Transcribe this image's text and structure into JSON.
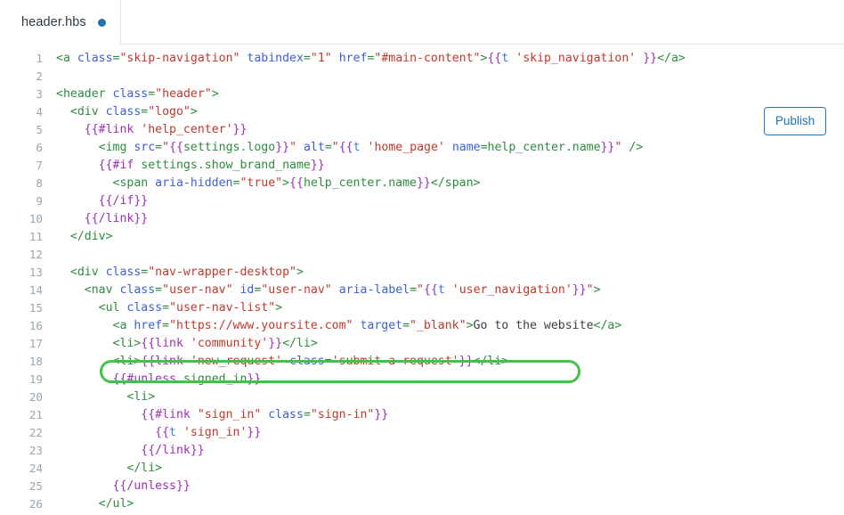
{
  "tab": {
    "filename": "header.hbs",
    "unsaved_indicator": "unsaved-dot",
    "accent_color": "#1f73b7"
  },
  "toolbar": {
    "publish_label": "Publish",
    "publish_color": "#1f73b7"
  },
  "highlight": {
    "color": "#44c148",
    "target_line": 16
  },
  "editor": {
    "language": "handlebars",
    "first_visible_line": 1,
    "last_visible_line": 26,
    "lines": [
      {
        "n": "1",
        "tokens": [
          {
            "t": "tag",
            "s": "<a "
          },
          {
            "t": "attr",
            "s": "class"
          },
          {
            "t": "tag",
            "s": "="
          },
          {
            "t": "str",
            "s": "\"skip-navigation\""
          },
          {
            "t": "tag",
            "s": " "
          },
          {
            "t": "attr",
            "s": "tabindex"
          },
          {
            "t": "tag",
            "s": "="
          },
          {
            "t": "str",
            "s": "\"1\""
          },
          {
            "t": "tag",
            "s": " "
          },
          {
            "t": "attr",
            "s": "href"
          },
          {
            "t": "tag",
            "s": "="
          },
          {
            "t": "str",
            "s": "\"#main-content\""
          },
          {
            "t": "tag",
            "s": ">"
          },
          {
            "t": "hb",
            "s": "{{"
          },
          {
            "t": "hbid",
            "s": "t"
          },
          {
            "t": "plain",
            "s": " "
          },
          {
            "t": "str",
            "s": "'skip_navigation'"
          },
          {
            "t": "plain",
            "s": " "
          },
          {
            "t": "hb",
            "s": "}}"
          },
          {
            "t": "tag",
            "s": "</a>"
          }
        ]
      },
      {
        "n": "2",
        "tokens": []
      },
      {
        "n": "3",
        "tokens": [
          {
            "t": "tag",
            "s": "<header "
          },
          {
            "t": "attr",
            "s": "class"
          },
          {
            "t": "tag",
            "s": "="
          },
          {
            "t": "str",
            "s": "\"header\""
          },
          {
            "t": "tag",
            "s": ">"
          }
        ]
      },
      {
        "n": "4",
        "tokens": [
          {
            "t": "tag",
            "s": "  <div "
          },
          {
            "t": "attr",
            "s": "class"
          },
          {
            "t": "tag",
            "s": "="
          },
          {
            "t": "str",
            "s": "\"logo\""
          },
          {
            "t": "tag",
            "s": ">"
          }
        ]
      },
      {
        "n": "5",
        "tokens": [
          {
            "t": "plain",
            "s": "    "
          },
          {
            "t": "hb",
            "s": "{{#link"
          },
          {
            "t": "plain",
            "s": " "
          },
          {
            "t": "str",
            "s": "'help_center'"
          },
          {
            "t": "hb",
            "s": "}}"
          }
        ]
      },
      {
        "n": "6",
        "tokens": [
          {
            "t": "tag",
            "s": "      <img "
          },
          {
            "t": "attr",
            "s": "src"
          },
          {
            "t": "tag",
            "s": "="
          },
          {
            "t": "str",
            "s": "\""
          },
          {
            "t": "hb",
            "s": "{{"
          },
          {
            "t": "hbvar",
            "s": "settings.logo"
          },
          {
            "t": "hb",
            "s": "}}"
          },
          {
            "t": "str",
            "s": "\""
          },
          {
            "t": "tag",
            "s": " "
          },
          {
            "t": "attr",
            "s": "alt"
          },
          {
            "t": "tag",
            "s": "="
          },
          {
            "t": "str",
            "s": "\""
          },
          {
            "t": "hb",
            "s": "{{"
          },
          {
            "t": "hbid",
            "s": "t"
          },
          {
            "t": "plain",
            "s": " "
          },
          {
            "t": "str",
            "s": "'home_page'"
          },
          {
            "t": "plain",
            "s": " "
          },
          {
            "t": "attr",
            "s": "name"
          },
          {
            "t": "tag",
            "s": "="
          },
          {
            "t": "hbvar",
            "s": "help_center.name"
          },
          {
            "t": "hb",
            "s": "}}"
          },
          {
            "t": "str",
            "s": "\""
          },
          {
            "t": "tag",
            "s": " />"
          }
        ]
      },
      {
        "n": "7",
        "tokens": [
          {
            "t": "plain",
            "s": "      "
          },
          {
            "t": "hb",
            "s": "{{#if"
          },
          {
            "t": "plain",
            "s": " "
          },
          {
            "t": "hbvar",
            "s": "settings.show_brand_name"
          },
          {
            "t": "hb",
            "s": "}}"
          }
        ]
      },
      {
        "n": "8",
        "tokens": [
          {
            "t": "tag",
            "s": "        <span "
          },
          {
            "t": "attr",
            "s": "aria-hidden"
          },
          {
            "t": "tag",
            "s": "="
          },
          {
            "t": "str",
            "s": "\"true\""
          },
          {
            "t": "tag",
            "s": ">"
          },
          {
            "t": "hb",
            "s": "{{"
          },
          {
            "t": "hbvar",
            "s": "help_center.name"
          },
          {
            "t": "hb",
            "s": "}}"
          },
          {
            "t": "tag",
            "s": "</span>"
          }
        ]
      },
      {
        "n": "9",
        "tokens": [
          {
            "t": "plain",
            "s": "      "
          },
          {
            "t": "hb",
            "s": "{{/if}}"
          }
        ]
      },
      {
        "n": "10",
        "tokens": [
          {
            "t": "plain",
            "s": "    "
          },
          {
            "t": "hb",
            "s": "{{/link}}"
          }
        ]
      },
      {
        "n": "11",
        "tokens": [
          {
            "t": "tag",
            "s": "  </div>"
          }
        ]
      },
      {
        "n": "12",
        "tokens": []
      },
      {
        "n": "13",
        "tokens": [
          {
            "t": "tag",
            "s": "  <div "
          },
          {
            "t": "attr",
            "s": "class"
          },
          {
            "t": "tag",
            "s": "="
          },
          {
            "t": "str",
            "s": "\"nav-wrapper-desktop\""
          },
          {
            "t": "tag",
            "s": ">"
          }
        ]
      },
      {
        "n": "14",
        "tokens": [
          {
            "t": "tag",
            "s": "    <nav "
          },
          {
            "t": "attr",
            "s": "class"
          },
          {
            "t": "tag",
            "s": "="
          },
          {
            "t": "str",
            "s": "\"user-nav\""
          },
          {
            "t": "tag",
            "s": " "
          },
          {
            "t": "attr",
            "s": "id"
          },
          {
            "t": "tag",
            "s": "="
          },
          {
            "t": "str",
            "s": "\"user-nav\""
          },
          {
            "t": "tag",
            "s": " "
          },
          {
            "t": "attr",
            "s": "aria-label"
          },
          {
            "t": "tag",
            "s": "="
          },
          {
            "t": "str",
            "s": "\""
          },
          {
            "t": "hb",
            "s": "{{"
          },
          {
            "t": "hbid",
            "s": "t"
          },
          {
            "t": "plain",
            "s": " "
          },
          {
            "t": "str",
            "s": "'user_navigation'"
          },
          {
            "t": "hb",
            "s": "}}"
          },
          {
            "t": "str",
            "s": "\""
          },
          {
            "t": "tag",
            "s": ">"
          }
        ]
      },
      {
        "n": "15",
        "tokens": [
          {
            "t": "tag",
            "s": "      <ul "
          },
          {
            "t": "attr",
            "s": "class"
          },
          {
            "t": "tag",
            "s": "="
          },
          {
            "t": "str",
            "s": "\"user-nav-list\""
          },
          {
            "t": "tag",
            "s": ">"
          }
        ]
      },
      {
        "n": "16",
        "tokens": [
          {
            "t": "tag",
            "s": "        <a "
          },
          {
            "t": "attr",
            "s": "href"
          },
          {
            "t": "tag",
            "s": "="
          },
          {
            "t": "str",
            "s": "\"https://www.yoursite.com\""
          },
          {
            "t": "tag",
            "s": " "
          },
          {
            "t": "attr",
            "s": "target"
          },
          {
            "t": "tag",
            "s": "="
          },
          {
            "t": "str",
            "s": "\"_blank\""
          },
          {
            "t": "tag",
            "s": ">"
          },
          {
            "t": "plain",
            "s": "Go to the website"
          },
          {
            "t": "tag",
            "s": "</a>"
          }
        ]
      },
      {
        "n": "17",
        "tokens": [
          {
            "t": "tag",
            "s": "        <li>"
          },
          {
            "t": "hb",
            "s": "{{link"
          },
          {
            "t": "plain",
            "s": " "
          },
          {
            "t": "str",
            "s": "'community'"
          },
          {
            "t": "hb",
            "s": "}}"
          },
          {
            "t": "tag",
            "s": "</li>"
          }
        ]
      },
      {
        "n": "18",
        "tokens": [
          {
            "t": "tag",
            "s": "        <li>"
          },
          {
            "t": "hb",
            "s": "{{link"
          },
          {
            "t": "plain",
            "s": " "
          },
          {
            "t": "str",
            "s": "'new_request'"
          },
          {
            "t": "plain",
            "s": " "
          },
          {
            "t": "attr",
            "s": "class"
          },
          {
            "t": "tag",
            "s": "="
          },
          {
            "t": "str",
            "s": "'submit-a-request'"
          },
          {
            "t": "hb",
            "s": "}}"
          },
          {
            "t": "tag",
            "s": "</li>"
          }
        ]
      },
      {
        "n": "19",
        "tokens": [
          {
            "t": "plain",
            "s": "        "
          },
          {
            "t": "hb",
            "s": "{{#unless"
          },
          {
            "t": "plain",
            "s": " "
          },
          {
            "t": "hbvar",
            "s": "signed_in"
          },
          {
            "t": "hb",
            "s": "}}"
          }
        ]
      },
      {
        "n": "20",
        "tokens": [
          {
            "t": "tag",
            "s": "          <li>"
          }
        ]
      },
      {
        "n": "21",
        "tokens": [
          {
            "t": "plain",
            "s": "            "
          },
          {
            "t": "hb",
            "s": "{{#link"
          },
          {
            "t": "plain",
            "s": " "
          },
          {
            "t": "str",
            "s": "\"sign_in\""
          },
          {
            "t": "plain",
            "s": " "
          },
          {
            "t": "attr",
            "s": "class"
          },
          {
            "t": "tag",
            "s": "="
          },
          {
            "t": "str",
            "s": "\"sign-in\""
          },
          {
            "t": "hb",
            "s": "}}"
          }
        ]
      },
      {
        "n": "22",
        "tokens": [
          {
            "t": "plain",
            "s": "              "
          },
          {
            "t": "hb",
            "s": "{{"
          },
          {
            "t": "hbid",
            "s": "t"
          },
          {
            "t": "plain",
            "s": " "
          },
          {
            "t": "str",
            "s": "'sign_in'"
          },
          {
            "t": "hb",
            "s": "}}"
          }
        ]
      },
      {
        "n": "23",
        "tokens": [
          {
            "t": "plain",
            "s": "            "
          },
          {
            "t": "hb",
            "s": "{{/link}}"
          }
        ]
      },
      {
        "n": "24",
        "tokens": [
          {
            "t": "tag",
            "s": "          </li>"
          }
        ]
      },
      {
        "n": "25",
        "tokens": [
          {
            "t": "plain",
            "s": "        "
          },
          {
            "t": "hb",
            "s": "{{/unless}}"
          }
        ]
      },
      {
        "n": "26",
        "tokens": [
          {
            "t": "tag",
            "s": "      </ul>"
          }
        ]
      }
    ]
  }
}
